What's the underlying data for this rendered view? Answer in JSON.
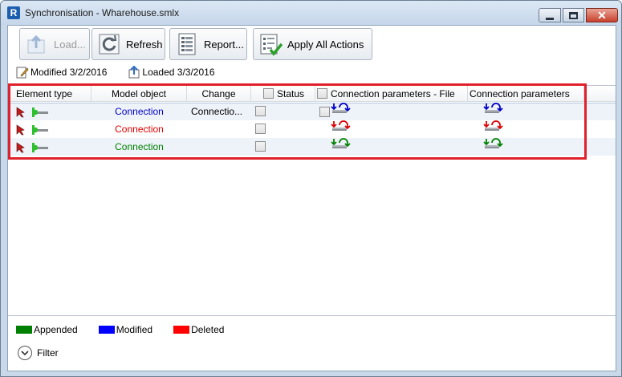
{
  "window": {
    "title": "Synchronisation - Wharehouse.smlx",
    "app_icon_letter": "R",
    "close_glyph": "✕"
  },
  "toolbar": {
    "load_label": "Load...",
    "refresh_label": "Refresh",
    "report_label": "Report...",
    "apply_label": "Apply All Actions"
  },
  "status": {
    "modified": "Modified 3/2/2016",
    "loaded": "Loaded 3/3/2016"
  },
  "table": {
    "columns": {
      "element_type": "Element type",
      "model_object": "Model object",
      "change": "Change",
      "status": "Status",
      "conn_params_file": "Connection parameters - File",
      "conn_params": "Connection parameters"
    },
    "rows": [
      {
        "model_object": "Connection",
        "change": "Connectio...",
        "color": "#0000cc"
      },
      {
        "model_object": "Connection",
        "change": "",
        "color": "#dd0000"
      },
      {
        "model_object": "Connection",
        "change": "",
        "color": "#008000"
      }
    ]
  },
  "legend": {
    "items": [
      {
        "label": "Appended",
        "color": "#008000"
      },
      {
        "label": "Modified",
        "color": "#0000ff"
      },
      {
        "label": "Deleted",
        "color": "#ff0000"
      }
    ]
  },
  "filter": {
    "label": "Filter",
    "icon": "chevron-down-icon"
  },
  "colors": {
    "highlight": "#e0202a",
    "row_alt": "#eef3f9"
  }
}
